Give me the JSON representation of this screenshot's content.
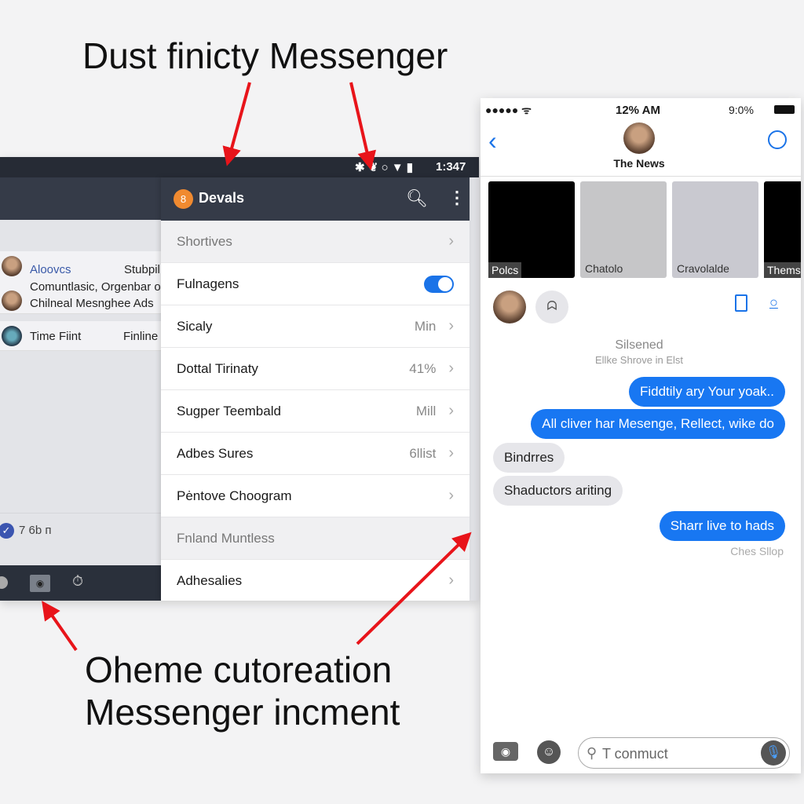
{
  "top_caption": "Dust finicty Messenger",
  "bottom_caption": [
    "Oheme cutoreation",
    "Messenger incment"
  ],
  "android": {
    "status_time": "1:347",
    "conversations": [
      {
        "name": "Aloovcs",
        "preview": "Stubpil"
      },
      {
        "name": "Comuntlasic, Orgenbar o",
        "preview": "Chilneal Mesnghee Ads"
      },
      {
        "name": "Time Fiint",
        "preview": "Finline"
      }
    ],
    "footer_status": "7 6b п",
    "drawer": {
      "title": "Devals",
      "items": [
        {
          "label": "Shortives",
          "value": "",
          "style": "section"
        },
        {
          "label": "Fulnagens",
          "toggle": true
        },
        {
          "label": "Sicaly",
          "value": "Min"
        },
        {
          "label": "Dottal Tirinaty",
          "value": "41%"
        },
        {
          "label": "Sugper Teembald",
          "value": "Mill"
        },
        {
          "label": "Adbes Sures",
          "value": "6llist"
        },
        {
          "label": "Pėntove Choogram",
          "value": ""
        },
        {
          "label": "Fnland Muntless",
          "style": "section"
        },
        {
          "label": "Adhesalies",
          "value": ""
        }
      ]
    }
  },
  "iphone": {
    "time": "12% AM",
    "battery": "9:0%",
    "contact": "The News",
    "tiles": [
      "Polcs",
      "Chatolo",
      "Cravolalde",
      "Thems"
    ],
    "status_title": "Silsened",
    "status_sub": "Ellke Shrove in Elst",
    "messages": [
      {
        "text": "Fiddtily ary Your yoak..",
        "dir": "out"
      },
      {
        "text": "All cliver har Mesenge, Rellect, wike do",
        "dir": "out"
      },
      {
        "text": "Bindrres",
        "dir": "in"
      },
      {
        "text": "Shaductors ariting",
        "dir": "in"
      },
      {
        "text": "Sharr live to hads",
        "dir": "out"
      }
    ],
    "receipt": "Ches Sllop",
    "input_placeholder": "T conmuct",
    "accent": "#1877f2"
  }
}
